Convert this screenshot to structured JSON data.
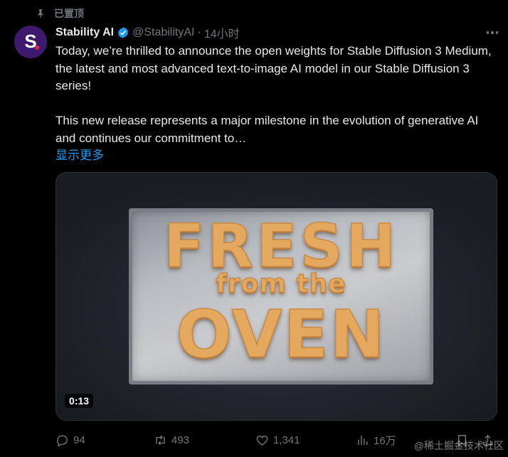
{
  "pinned_label": "已置顶",
  "author": {
    "display_name": "Stability AI",
    "handle": "@StabilityAI",
    "separator": "·",
    "time": "14小时",
    "avatar_letter": "S",
    "avatar_bg": "#3d1a6e",
    "avatar_dot_color": "#e5244f"
  },
  "tweet": {
    "paragraph_1": "Today, we’re thrilled to announce the open weights for Stable Diffusion 3 Medium, the latest and most advanced text-to-image AI model in our Stable Diffusion 3 series!",
    "paragraph_2": "This new release represents a major milestone in the evolution of generative AI and continues our commitment to…",
    "show_more": "显示更多"
  },
  "media": {
    "line_1": "FRESH",
    "line_2": "from the",
    "line_3": "OVEN",
    "duration": "0:13"
  },
  "actions": {
    "replies": "94",
    "retweets": "493",
    "likes": "1,341",
    "views": "16万"
  },
  "icons": {
    "pin": "pin-icon",
    "verified": "verified-badge-icon",
    "more": "more-dots-icon",
    "reply": "reply-icon",
    "retweet": "retweet-icon",
    "like": "heart-icon",
    "views": "views-chart-icon",
    "bookmark": "bookmark-icon",
    "share": "share-icon"
  },
  "colors": {
    "background": "#000000",
    "link": "#1d9bf0",
    "muted": "#71767b",
    "verified": "#1d9bf0"
  },
  "watermark": "@稀土掘金技术社区"
}
